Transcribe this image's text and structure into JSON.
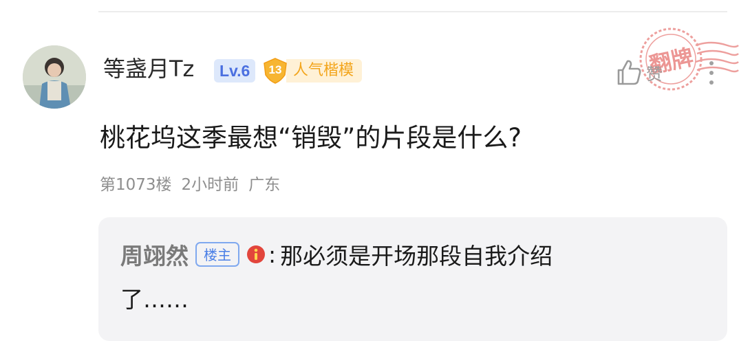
{
  "comment": {
    "username": "等盏月Tz",
    "level_badge": "Lv.6",
    "popularity": {
      "count": "13",
      "label": "人气楷模"
    },
    "like_label": "赞",
    "stamp_text": "翻牌",
    "question": "桃花坞这季最想“销毁”的片段是什么?",
    "meta": {
      "floor": "第1073楼",
      "time": "2小时前",
      "location": "广东"
    },
    "reply": {
      "user": "周翊然",
      "owner_badge": "楼主",
      "colon": ":",
      "text_line1": "那必须是开场那段自我介绍",
      "text_line2": "了……"
    }
  },
  "colors": {
    "level_badge_bg": "#dde8fb",
    "level_badge_text": "#4a6fe0",
    "popularity_orange": "#f3a51c",
    "owner_badge_blue": "#4a7fe6",
    "stamp_red": "#e0524e",
    "warn_red": "#e2453c"
  },
  "icons": [
    "avatar",
    "popularity-shield-icon",
    "thumbs-up-icon",
    "more-options-icon",
    "warning-icon"
  ]
}
